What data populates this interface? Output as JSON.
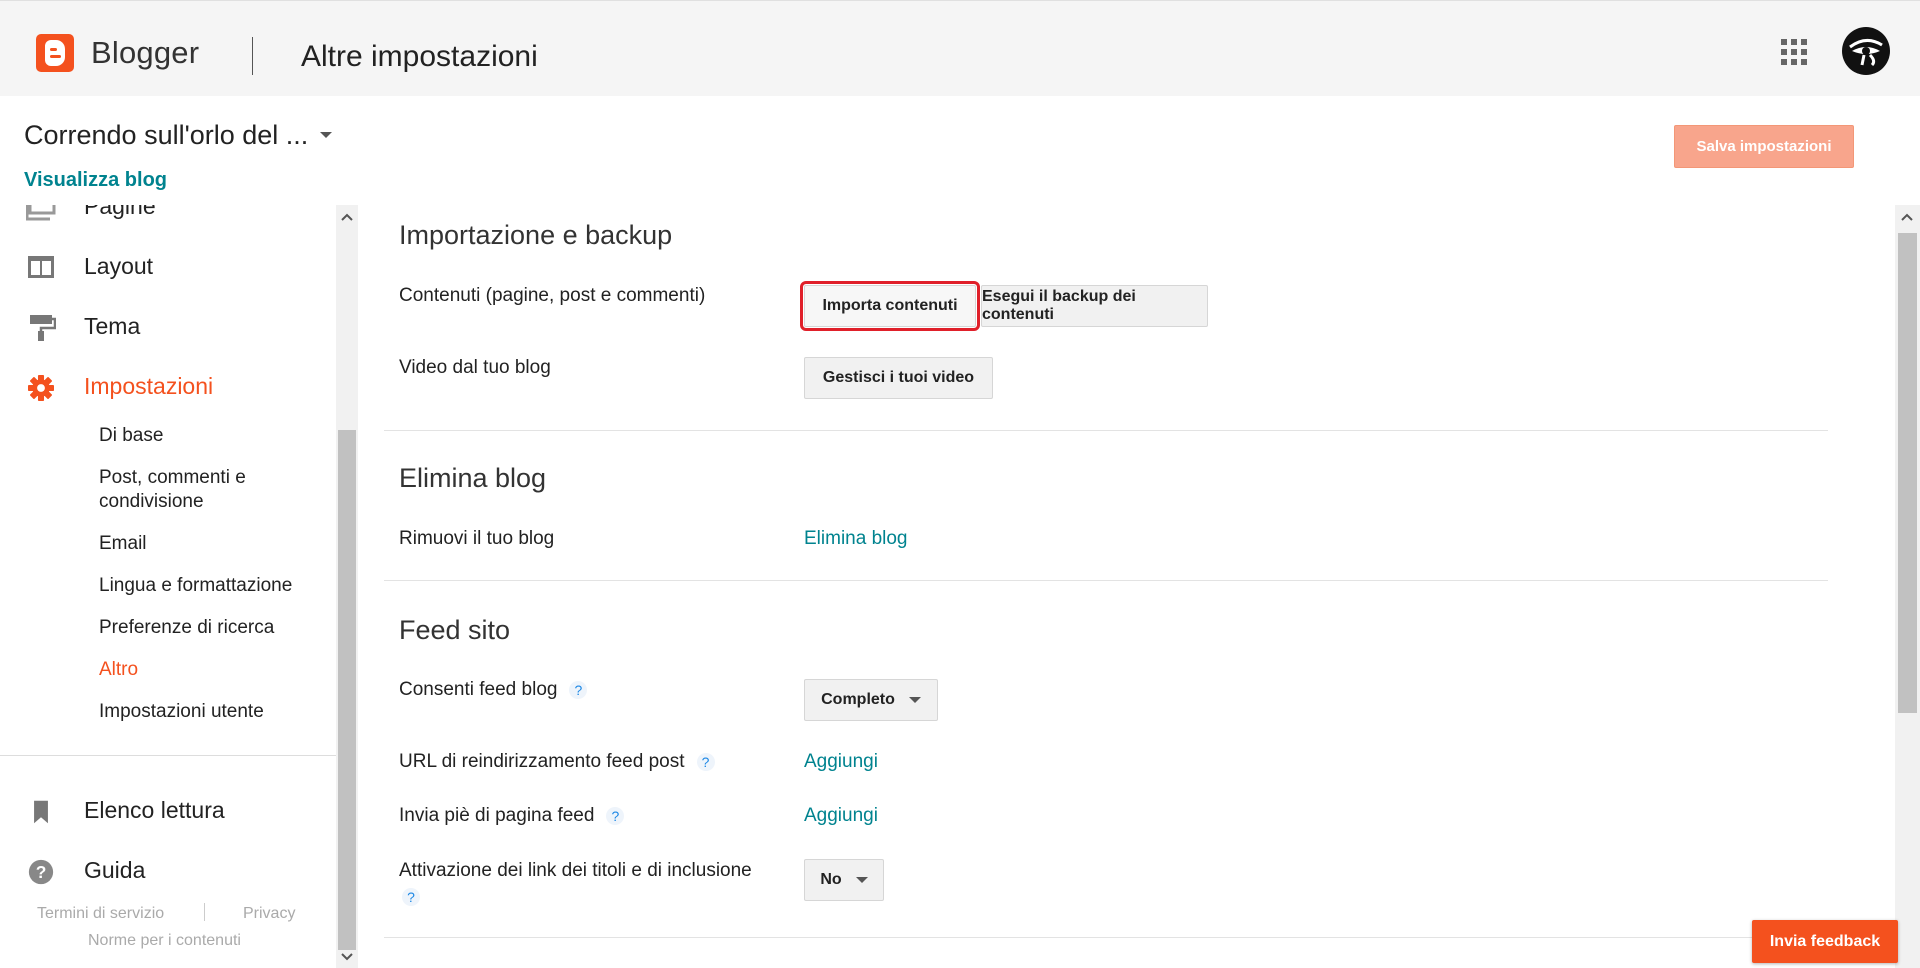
{
  "app": {
    "brand": "Blogger",
    "page_title": "Altre impostazioni"
  },
  "blog": {
    "name": "Correndo sull'orlo del ...",
    "view_link": "Visualizza blog"
  },
  "toolbar": {
    "save_label": "Salva impostazioni"
  },
  "sidebar": {
    "items": [
      {
        "label": "Pagine",
        "icon": "pages-icon"
      },
      {
        "label": "Layout",
        "icon": "layout-icon"
      },
      {
        "label": "Tema",
        "icon": "paint-roller-icon"
      },
      {
        "label": "Impostazioni",
        "icon": "gear-icon",
        "active": true
      }
    ],
    "subitems": [
      "Di base",
      "Post, commenti e condivisione",
      "Email",
      "Lingua e formattazione",
      "Preferenze di ricerca",
      "Altro",
      "Impostazioni utente"
    ],
    "active_subitem": "Altro",
    "bottom_items": [
      {
        "label": "Elenco lettura",
        "icon": "bookmark-icon"
      },
      {
        "label": "Guida",
        "icon": "help-circle-icon"
      }
    ],
    "footer": {
      "terms": "Termini di servizio",
      "privacy": "Privacy",
      "content_policy": "Norme per i contenuti"
    }
  },
  "sections": {
    "import": {
      "title": "Importazione e backup",
      "content_label": "Contenuti (pagine, post e commenti)",
      "import_btn": "Importa contenuti",
      "backup_btn": "Esegui il backup dei contenuti",
      "video_label": "Video dal tuo blog",
      "video_btn": "Gestisci i tuoi video"
    },
    "delete": {
      "title": "Elimina blog",
      "remove_label": "Rimuovi il tuo blog",
      "delete_link": "Elimina blog"
    },
    "feed": {
      "title": "Feed sito",
      "allow_label": "Consenti feed blog",
      "allow_value": "Completo",
      "redirect_label": "URL di reindirizzamento feed post",
      "redirect_link": "Aggiungi",
      "footer_label": "Invia piè di pagina feed",
      "footer_link": "Aggiungi",
      "title_links_label": "Attivazione dei link dei titoli e di inclusione",
      "title_links_value": "No",
      "help_mark": "?"
    }
  },
  "feedback": {
    "label": "Invia feedback"
  },
  "colors": {
    "accent": "#f4511e",
    "link": "#00838f",
    "highlight": "#e0202a"
  }
}
